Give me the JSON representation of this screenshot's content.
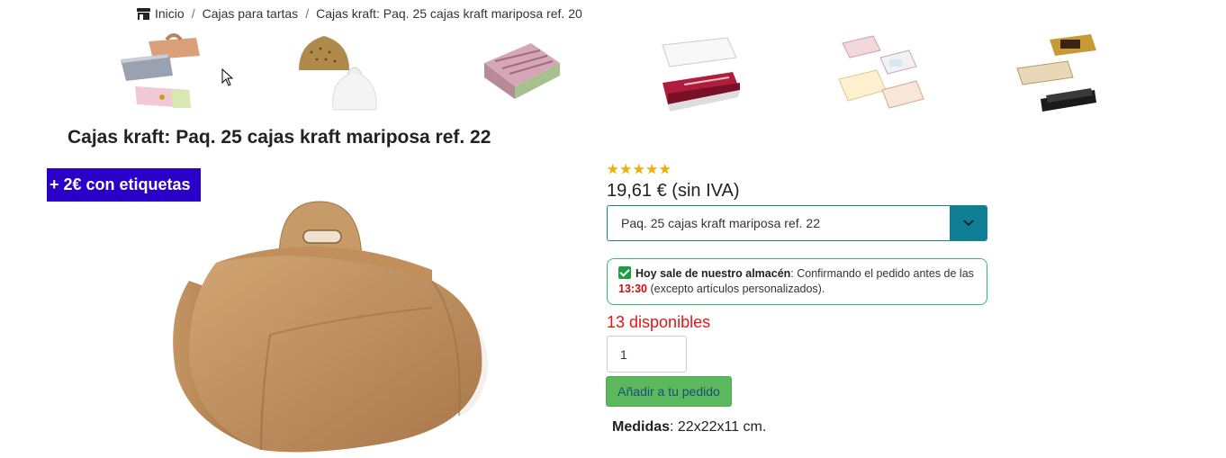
{
  "breadcrumb": {
    "home_icon": "shop-icon",
    "items": [
      "Inicio",
      "Cajas para tartas",
      "Cajas kraft: Paq. 25 cajas kraft mariposa ref. 20"
    ],
    "separator": "/"
  },
  "thumbnails": [
    {
      "name": "thumb-assorted-boxes",
      "icon": "box-assortment-image"
    },
    {
      "name": "thumb-butterfly-boxes",
      "icon": "butterfly-box-image"
    },
    {
      "name": "thumb-printed-cake-box",
      "icon": "printed-box-image"
    },
    {
      "name": "thumb-red-pastry-tray",
      "icon": "pastry-tray-image"
    },
    {
      "name": "thumb-window-boxes",
      "icon": "window-box-image"
    },
    {
      "name": "thumb-gold-black-trays",
      "icon": "gold-tray-image"
    }
  ],
  "product": {
    "title": "Cajas kraft: Paq. 25 cajas kraft mariposa ref. 22",
    "label_badge": "+ 2€ con etiquetas",
    "rating": 5,
    "rating_max": 5,
    "price": "19,61 € (sin IVA)",
    "variant": {
      "selected": "Paq. 25 cajas kraft mariposa ref. 22",
      "icon": "chevron-down-icon"
    },
    "shipping": {
      "icon": "check-icon",
      "strong": "Hoy sale de nuestro almacén",
      "text_before_time": ": Confirmando el pedido antes de las",
      "time": "13:30",
      "text_after_time": " (excepto artículos personalizados)."
    },
    "stock": "13 disponibles",
    "quantity": "1",
    "add_button": "Añadir a tu pedido",
    "measures_label": "Medidas",
    "measures_value": ": 22x22x11 cm."
  },
  "colors": {
    "badge_bg": "#2a00c8",
    "select_accent": "#107f95",
    "ship_border": "#2ebd68",
    "stock_red": "#e41515",
    "button_green": "#5cb85c"
  }
}
